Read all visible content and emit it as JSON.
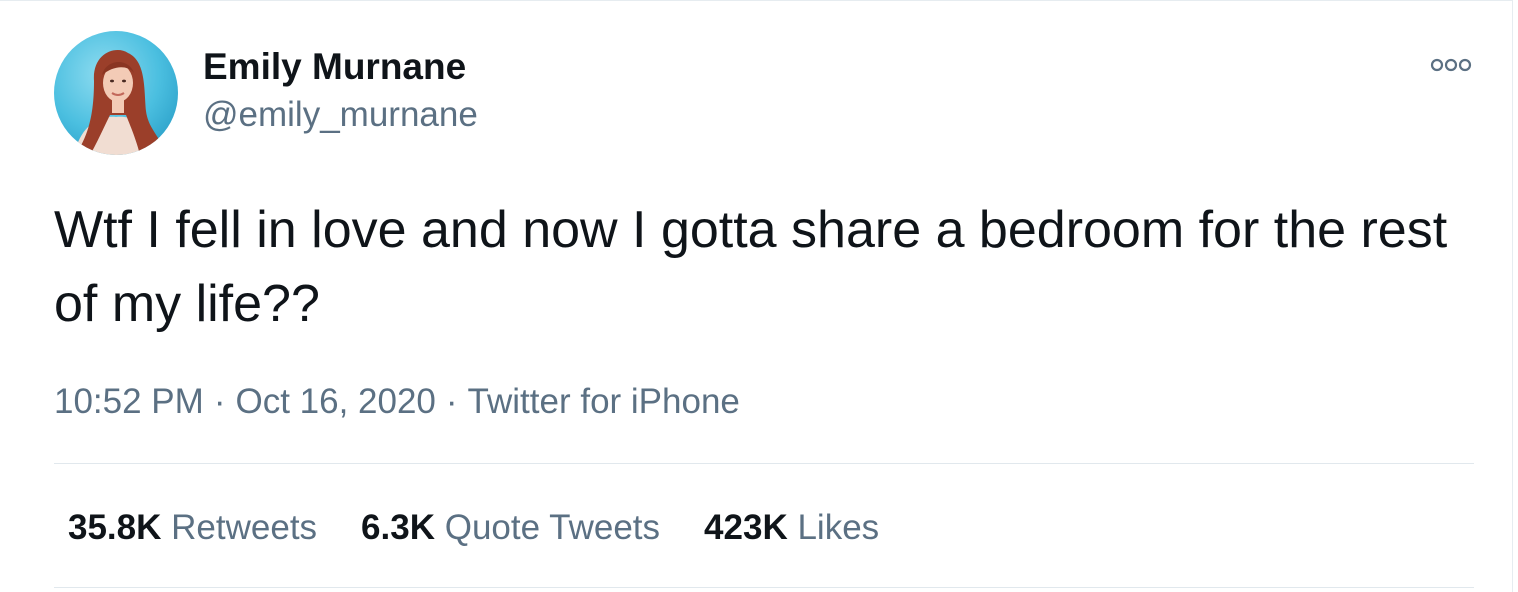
{
  "tweet": {
    "author": {
      "display_name": "Emily Murnane",
      "handle": "@emily_murnane"
    },
    "text": "Wtf I fell in love and now I gotta share a bedroom for the rest of my life??",
    "time": "10:52 PM",
    "separator": "·",
    "date": "Oct 16, 2020",
    "source": "Twitter for iPhone",
    "stats": {
      "retweets_count": "35.8K",
      "retweets_label": "Retweets",
      "quotes_count": "6.3K",
      "quotes_label": "Quote Tweets",
      "likes_count": "423K",
      "likes_label": "Likes"
    }
  },
  "colors": {
    "text_primary": "#0f1419",
    "text_secondary": "#5b7083",
    "divider": "#e1e8ed"
  },
  "icons": {
    "more": "more-horizontal-icon"
  }
}
